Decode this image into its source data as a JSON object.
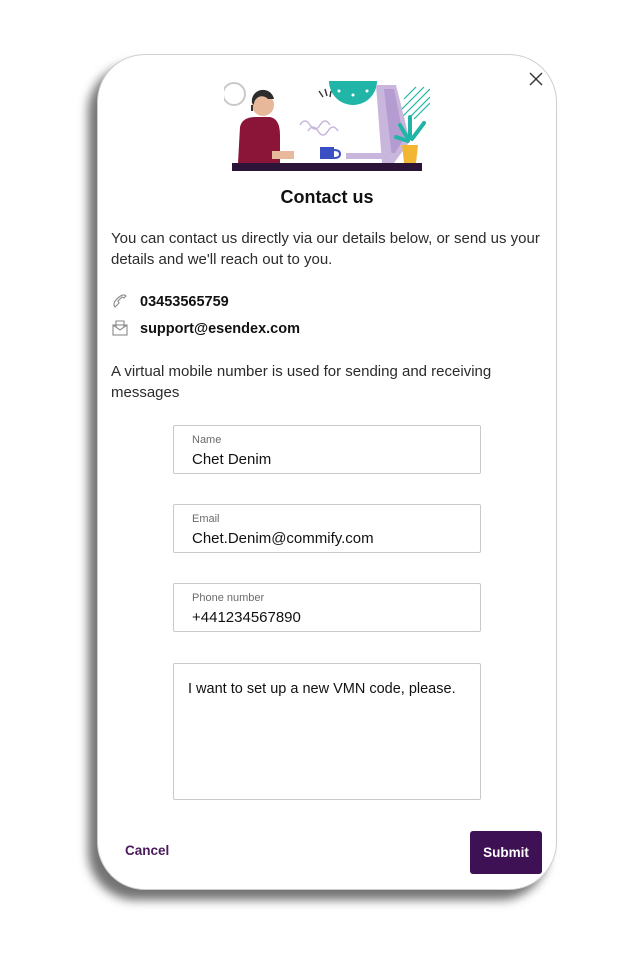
{
  "dialog": {
    "title": "Contact us",
    "intro": "You can contact us directly via our details below, or send us your details and we'll reach out to you.",
    "phone": "03453565759",
    "email": "support@esendex.com",
    "vmn_note": "A virtual mobile number is used for sending and receiving messages"
  },
  "form": {
    "name": {
      "label": "Name",
      "value": "Chet Denim"
    },
    "email": {
      "label": "Email",
      "value": "Chet.Denim@commify.com"
    },
    "phone": {
      "label": "Phone number",
      "value": "+441234567890"
    },
    "message": {
      "value": "I want to set up a new VMN code, please."
    }
  },
  "actions": {
    "cancel_label": "Cancel",
    "submit_label": "Submit"
  },
  "colors": {
    "primary": "#3d1153",
    "link": "#4a1a5c",
    "illustration_teal": "#21b5a8",
    "illustration_maroon": "#8b1538"
  },
  "icons": [
    "close-icon",
    "phone-icon",
    "email-icon"
  ]
}
